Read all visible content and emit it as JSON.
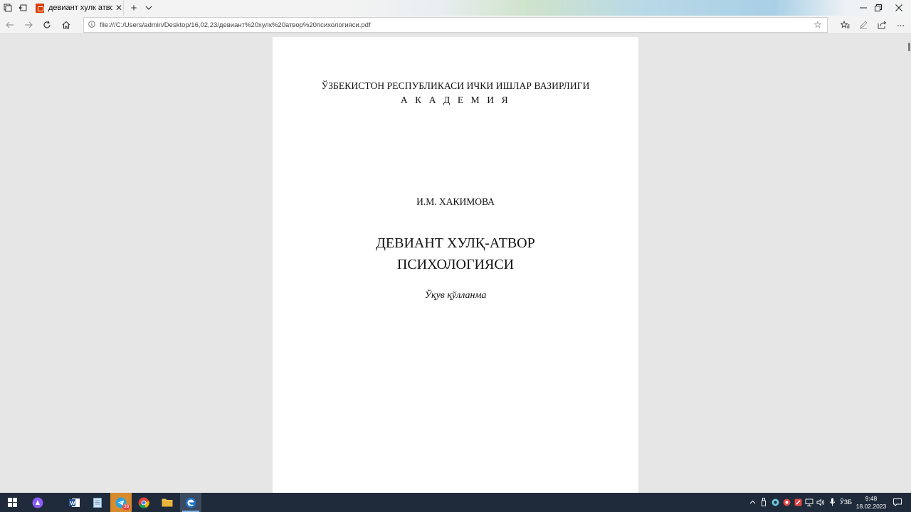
{
  "browser": {
    "tab_title": "девиант хулк атвор пси",
    "tab_close": "✕",
    "new_tab": "+",
    "url": "file:///C:/Users/admin/Desktop/16,02,23/девиант%20хулк%20атвор%20психологияси.pdf"
  },
  "document": {
    "ministry": "ЎЗБЕКИСТОН РЕСПУБЛИКАСИ ИЧКИ ИШЛАР ВАЗИРЛИГИ",
    "academy": "А К А Д Е М И Я",
    "author": "И.М. ХАКИМОВА",
    "title_line1": "ДЕВИАНТ ХУЛҚ-АТВОР",
    "title_line2": "ПСИХОЛОГИЯСИ",
    "subtitle": "Ўқув қўлланма"
  },
  "taskbar": {
    "telegram_badge": "38",
    "language": "ЎЗБ",
    "time": "9:48",
    "date": "18.02.2023"
  },
  "colors": {
    "accent_pdf": "#d83b01",
    "taskbar": "#1f2a3a"
  }
}
